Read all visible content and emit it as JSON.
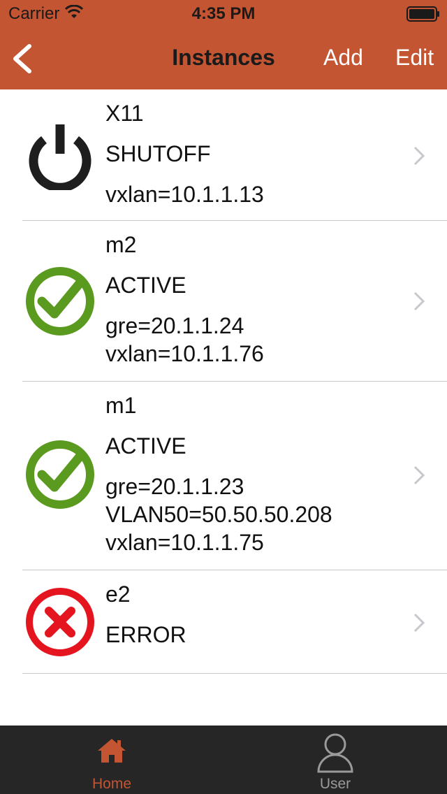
{
  "status_bar": {
    "carrier": "Carrier",
    "time": "4:35 PM"
  },
  "nav": {
    "title": "Instances",
    "add_label": "Add",
    "edit_label": "Edit",
    "back_icon": "chevron-left-icon"
  },
  "colors": {
    "bar": "#c45532",
    "active_green": "#5a9a1e",
    "error_red": "#e4151f",
    "shutoff_dark": "#1e1e1e",
    "tab_bar": "#262626",
    "tab_active": "#c45532",
    "tab_inactive": "#9a9a9a"
  },
  "instances": [
    {
      "name": "X11",
      "status": "SHUTOFF",
      "icon": "power-icon",
      "networks": [
        "vxlan=10.1.1.13"
      ]
    },
    {
      "name": "m2",
      "status": "ACTIVE",
      "icon": "check-circle-icon",
      "networks": [
        "gre=20.1.1.24",
        "vxlan=10.1.1.76"
      ]
    },
    {
      "name": "m1",
      "status": "ACTIVE",
      "icon": "check-circle-icon",
      "networks": [
        "gre=20.1.1.23",
        "VLAN50=50.50.50.208",
        "vxlan=10.1.1.75"
      ]
    },
    {
      "name": "e2",
      "status": "ERROR",
      "icon": "error-circle-icon",
      "networks": []
    }
  ],
  "tabs": [
    {
      "label": "Home",
      "icon": "home-icon",
      "active": true
    },
    {
      "label": "User",
      "icon": "user-icon",
      "active": false
    }
  ]
}
